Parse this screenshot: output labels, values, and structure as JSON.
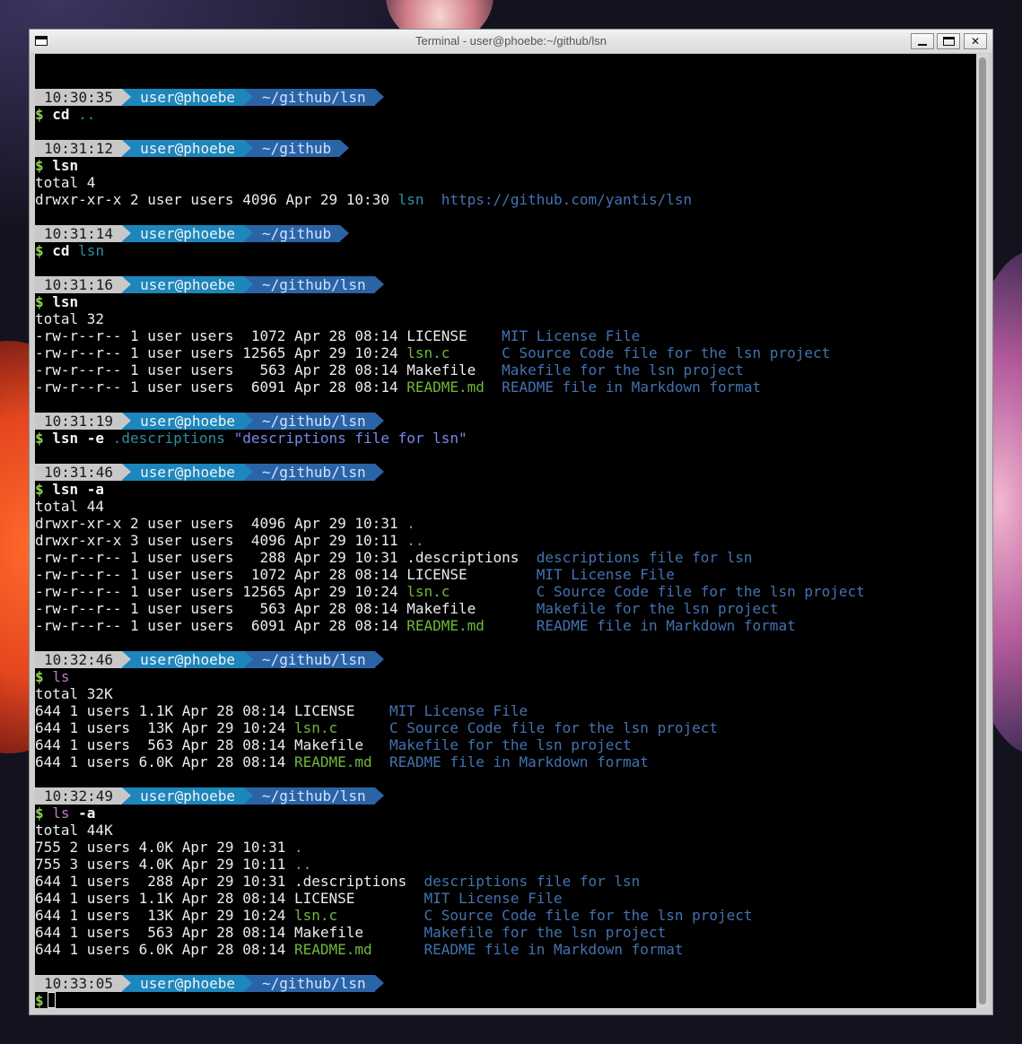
{
  "window": {
    "title": "Terminal - user@phoebe:~/github/lsn",
    "buttons": {
      "minimize": "minimize",
      "maximize": "maximize",
      "close": "✕"
    }
  },
  "colors": {
    "prompt_time_bg": "#c8c8c8",
    "prompt_user_bg": "#1c86bd",
    "prompt_dir_bg": "#2b64a6",
    "dollar": "#8fd14f",
    "filename_green": "#6fb83a",
    "description_blue": "#4472b0"
  },
  "terminal": {
    "lines": [
      {
        "type": "blank"
      },
      {
        "type": "prompt",
        "time": "10:30:35",
        "user": "user@phoebe",
        "dir": "~/github/lsn"
      },
      {
        "type": "cmd",
        "parts": [
          {
            "t": "$ ",
            "c": "dollar"
          },
          {
            "t": "cd ",
            "c": "cmd"
          },
          {
            "t": "..",
            "c": "arg"
          }
        ]
      },
      {
        "type": "blank"
      },
      {
        "type": "prompt",
        "time": "10:31:12",
        "user": "user@phoebe",
        "dir": "~/github"
      },
      {
        "type": "cmd",
        "parts": [
          {
            "t": "$ ",
            "c": "dollar"
          },
          {
            "t": "lsn",
            "c": "cmd"
          }
        ]
      },
      {
        "type": "out",
        "parts": [
          {
            "t": "total 4"
          }
        ]
      },
      {
        "type": "out",
        "parts": [
          {
            "t": "drwxr-xr-x 2 user users 4096 Apr 29 10:30 "
          },
          {
            "t": "lsn",
            "c": "arg"
          },
          {
            "t": "  "
          },
          {
            "t": "https://github.com/yantis/lsn",
            "c": "link"
          }
        ]
      },
      {
        "type": "blank"
      },
      {
        "type": "prompt",
        "time": "10:31:14",
        "user": "user@phoebe",
        "dir": "~/github"
      },
      {
        "type": "cmd",
        "parts": [
          {
            "t": "$ ",
            "c": "dollar"
          },
          {
            "t": "cd ",
            "c": "cmd"
          },
          {
            "t": "lsn",
            "c": "arg"
          }
        ]
      },
      {
        "type": "blank"
      },
      {
        "type": "prompt",
        "time": "10:31:16",
        "user": "user@phoebe",
        "dir": "~/github/lsn"
      },
      {
        "type": "cmd",
        "parts": [
          {
            "t": "$ ",
            "c": "dollar"
          },
          {
            "t": "lsn",
            "c": "cmd"
          }
        ]
      },
      {
        "type": "out",
        "parts": [
          {
            "t": "total 32"
          }
        ]
      },
      {
        "type": "out",
        "parts": [
          {
            "t": "-rw-r--r-- 1 user users  1072 Apr 28 08:14 LICENSE    "
          },
          {
            "t": "MIT License File",
            "c": "desc"
          }
        ]
      },
      {
        "type": "out",
        "parts": [
          {
            "t": "-rw-r--r-- 1 user users 12565 Apr 29 10:24 "
          },
          {
            "t": "lsn.c",
            "c": "green"
          },
          {
            "t": "      "
          },
          {
            "t": "C Source Code file for the lsn project",
            "c": "desc"
          }
        ]
      },
      {
        "type": "out",
        "parts": [
          {
            "t": "-rw-r--r-- 1 user users   563 Apr 28 08:14 Makefile   "
          },
          {
            "t": "Makefile for the lsn project",
            "c": "desc"
          }
        ]
      },
      {
        "type": "out",
        "parts": [
          {
            "t": "-rw-r--r-- 1 user users  6091 Apr 28 08:14 "
          },
          {
            "t": "README.md",
            "c": "green"
          },
          {
            "t": "  "
          },
          {
            "t": "README file in Markdown format",
            "c": "desc"
          }
        ]
      },
      {
        "type": "blank"
      },
      {
        "type": "prompt",
        "time": "10:31:19",
        "user": "user@phoebe",
        "dir": "~/github/lsn"
      },
      {
        "type": "cmd",
        "parts": [
          {
            "t": "$ ",
            "c": "dollar"
          },
          {
            "t": "lsn -e ",
            "c": "cmd"
          },
          {
            "t": ".descriptions ",
            "c": "arg"
          },
          {
            "t": "\"descriptions file for lsn\"",
            "c": "arg-str"
          }
        ]
      },
      {
        "type": "blank"
      },
      {
        "type": "prompt",
        "time": "10:31:46",
        "user": "user@phoebe",
        "dir": "~/github/lsn"
      },
      {
        "type": "cmd",
        "parts": [
          {
            "t": "$ ",
            "c": "dollar"
          },
          {
            "t": "lsn -a",
            "c": "cmd"
          }
        ]
      },
      {
        "type": "out",
        "parts": [
          {
            "t": "total 44"
          }
        ]
      },
      {
        "type": "out",
        "parts": [
          {
            "t": "drwxr-xr-x 2 user users  4096 Apr 29 10:31 "
          },
          {
            "t": ".",
            "c": "dotted"
          }
        ]
      },
      {
        "type": "out",
        "parts": [
          {
            "t": "drwxr-xr-x 3 user users  4096 Apr 29 10:11 "
          },
          {
            "t": "..",
            "c": "dotted"
          }
        ]
      },
      {
        "type": "out",
        "parts": [
          {
            "t": "-rw-r--r-- 1 user users   288 Apr 29 10:31 .descriptions  "
          },
          {
            "t": "descriptions file for lsn",
            "c": "desc"
          }
        ]
      },
      {
        "type": "out",
        "parts": [
          {
            "t": "-rw-r--r-- 1 user users  1072 Apr 28 08:14 LICENSE        "
          },
          {
            "t": "MIT License File",
            "c": "desc"
          }
        ]
      },
      {
        "type": "out",
        "parts": [
          {
            "t": "-rw-r--r-- 1 user users 12565 Apr 29 10:24 "
          },
          {
            "t": "lsn.c",
            "c": "green"
          },
          {
            "t": "          "
          },
          {
            "t": "C Source Code file for the lsn project",
            "c": "desc"
          }
        ]
      },
      {
        "type": "out",
        "parts": [
          {
            "t": "-rw-r--r-- 1 user users   563 Apr 28 08:14 Makefile       "
          },
          {
            "t": "Makefile for the lsn project",
            "c": "desc"
          }
        ]
      },
      {
        "type": "out",
        "parts": [
          {
            "t": "-rw-r--r-- 1 user users  6091 Apr 28 08:14 "
          },
          {
            "t": "README.md",
            "c": "green"
          },
          {
            "t": "      "
          },
          {
            "t": "README file in Markdown format",
            "c": "desc"
          }
        ]
      },
      {
        "type": "blank"
      },
      {
        "type": "prompt",
        "time": "10:32:46",
        "user": "user@phoebe",
        "dir": "~/github/lsn"
      },
      {
        "type": "cmd",
        "parts": [
          {
            "t": "$ ",
            "c": "dollar"
          },
          {
            "t": "ls",
            "c": "cmd-ls"
          }
        ]
      },
      {
        "type": "out",
        "parts": [
          {
            "t": "total 32K"
          }
        ]
      },
      {
        "type": "out",
        "parts": [
          {
            "t": "644 1 users 1.1K Apr 28 08:14 LICENSE    "
          },
          {
            "t": "MIT License File",
            "c": "desc"
          }
        ]
      },
      {
        "type": "out",
        "parts": [
          {
            "t": "644 1 users  13K Apr 29 10:24 "
          },
          {
            "t": "lsn.c",
            "c": "green"
          },
          {
            "t": "      "
          },
          {
            "t": "C Source Code file for the lsn project",
            "c": "desc"
          }
        ]
      },
      {
        "type": "out",
        "parts": [
          {
            "t": "644 1 users  563 Apr 28 08:14 Makefile   "
          },
          {
            "t": "Makefile for the lsn project",
            "c": "desc"
          }
        ]
      },
      {
        "type": "out",
        "parts": [
          {
            "t": "644 1 users 6.0K Apr 28 08:14 "
          },
          {
            "t": "README.md",
            "c": "green"
          },
          {
            "t": "  "
          },
          {
            "t": "README file in Markdown format",
            "c": "desc"
          }
        ]
      },
      {
        "type": "blank"
      },
      {
        "type": "prompt",
        "time": "10:32:49",
        "user": "user@phoebe",
        "dir": "~/github/lsn"
      },
      {
        "type": "cmd",
        "parts": [
          {
            "t": "$ ",
            "c": "dollar"
          },
          {
            "t": "ls",
            "c": "cmd-ls"
          },
          {
            "t": " -a",
            "c": "cmd"
          }
        ]
      },
      {
        "type": "out",
        "parts": [
          {
            "t": "total 44K"
          }
        ]
      },
      {
        "type": "out",
        "parts": [
          {
            "t": "755 2 users 4.0K Apr 29 10:31 "
          },
          {
            "t": ".",
            "c": "dotted"
          }
        ]
      },
      {
        "type": "out",
        "parts": [
          {
            "t": "755 3 users 4.0K Apr 29 10:11 "
          },
          {
            "t": "..",
            "c": "dotted"
          }
        ]
      },
      {
        "type": "out",
        "parts": [
          {
            "t": "644 1 users  288 Apr 29 10:31 .descriptions  "
          },
          {
            "t": "descriptions file for lsn",
            "c": "desc"
          }
        ]
      },
      {
        "type": "out",
        "parts": [
          {
            "t": "644 1 users 1.1K Apr 28 08:14 LICENSE        "
          },
          {
            "t": "MIT License File",
            "c": "desc"
          }
        ]
      },
      {
        "type": "out",
        "parts": [
          {
            "t": "644 1 users  13K Apr 29 10:24 "
          },
          {
            "t": "lsn.c",
            "c": "green"
          },
          {
            "t": "          "
          },
          {
            "t": "C Source Code file for the lsn project",
            "c": "desc"
          }
        ]
      },
      {
        "type": "out",
        "parts": [
          {
            "t": "644 1 users  563 Apr 28 08:14 Makefile       "
          },
          {
            "t": "Makefile for the lsn project",
            "c": "desc"
          }
        ]
      },
      {
        "type": "out",
        "parts": [
          {
            "t": "644 1 users 6.0K Apr 28 08:14 "
          },
          {
            "t": "README.md",
            "c": "green"
          },
          {
            "t": "      "
          },
          {
            "t": "README file in Markdown format",
            "c": "desc"
          }
        ]
      },
      {
        "type": "blank"
      },
      {
        "type": "prompt",
        "time": "10:33:05",
        "user": "user@phoebe",
        "dir": "~/github/lsn"
      },
      {
        "type": "cursor",
        "parts": [
          {
            "t": "$",
            "c": "dollar"
          }
        ]
      }
    ]
  }
}
